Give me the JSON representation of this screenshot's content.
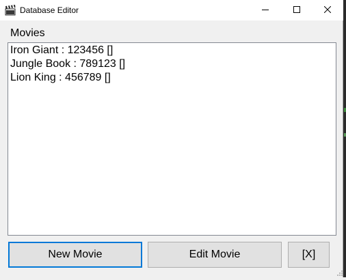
{
  "window": {
    "title": "Database Editor",
    "icon": "clapperboard-icon"
  },
  "titlebar_buttons": {
    "minimize_icon": "minimize-icon",
    "maximize_icon": "maximize-icon",
    "close_icon": "close-icon"
  },
  "movies_group": {
    "label": "Movies",
    "items": [
      {
        "label": "Iron Giant : 123456 []"
      },
      {
        "label": "Jungle Book : 789123 []"
      },
      {
        "label": "Lion King : 456789 []"
      }
    ]
  },
  "buttons": {
    "new_movie": "New Movie",
    "edit_movie": "Edit Movie",
    "close": "[X]"
  },
  "colors": {
    "focus_border": "#0078d7",
    "button_face": "#e1e1e1",
    "window_bg": "#f0f0f0"
  }
}
